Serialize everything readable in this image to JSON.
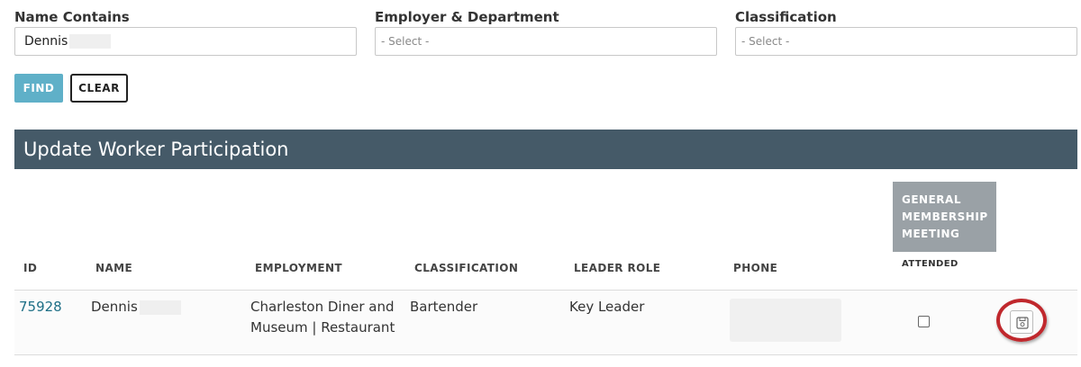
{
  "filters": {
    "name_label": "Name Contains",
    "name_value": "Dennis",
    "employer_label": "Employer & Department",
    "employer_placeholder": "- Select -",
    "classification_label": "Classification",
    "classification_placeholder": "- Select -"
  },
  "actions": {
    "find_label": "FIND",
    "clear_label": "CLEAR"
  },
  "section": {
    "title": "Update Worker Participation"
  },
  "table": {
    "meeting_header": "GENERAL MEMBERSHIP MEETING",
    "attended_header": "ATTENDED",
    "columns": {
      "id": "ID",
      "name": "NAME",
      "employment": "EMPLOYMENT",
      "classification": "CLASSIFICATION",
      "leader_role": "LEADER ROLE",
      "phone": "PHONE"
    },
    "rows": [
      {
        "id": "75928",
        "name": "Dennis",
        "employment_line1": "Charleston Diner and",
        "employment_line2": "Museum | Restaurant",
        "classification": "Bartender",
        "leader_role": "Key Leader",
        "attended": false
      }
    ]
  },
  "icons": {
    "save": "save-icon"
  },
  "colors": {
    "find_button": "#5fb0c8",
    "section_bar": "#455a68",
    "meeting_header": "#9aa1a6",
    "id_link": "#1e6f86",
    "highlight_ring": "#c0282d"
  }
}
